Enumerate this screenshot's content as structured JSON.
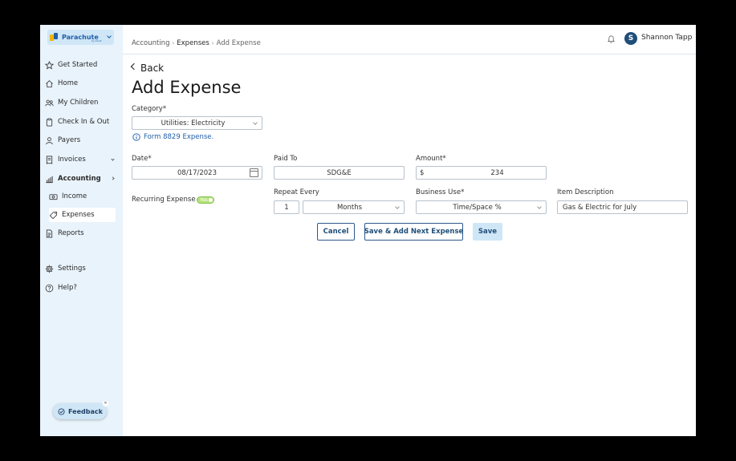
{
  "app": {
    "logo_text": "Parachute",
    "logo_sub": "by Intuit",
    "accent": "#1f5fa8"
  },
  "sidebar": {
    "items": [
      {
        "label": "Get Started",
        "icon": "star-icon"
      },
      {
        "label": "Home",
        "icon": "home-icon"
      },
      {
        "label": "My Children",
        "icon": "people-icon"
      },
      {
        "label": "Check In & Out",
        "icon": "clipboard-icon"
      },
      {
        "label": "Payers",
        "icon": "person-icon"
      },
      {
        "label": "Invoices",
        "icon": "invoice-icon"
      },
      {
        "label": "Accounting",
        "icon": "bar-chart-icon"
      },
      {
        "label": "Income",
        "icon": "cash-icon"
      },
      {
        "label": "Expenses",
        "icon": "tag-icon"
      },
      {
        "label": "Reports",
        "icon": "report-icon"
      },
      {
        "label": "Settings",
        "icon": "gear-icon"
      },
      {
        "label": "Help?",
        "icon": "help-icon"
      }
    ],
    "feedback_label": "Feedback"
  },
  "header": {
    "breadcrumb": [
      "Accounting",
      "Expenses",
      "Add Expense"
    ],
    "user_initial": "S",
    "user_name": "Shannon Tapp"
  },
  "form": {
    "back_label": "Back",
    "title": "Add Expense",
    "category_label": "Category*",
    "category_value": "Utilities: Electricity",
    "info_text": "Form 8829 Expense.",
    "date_label": "Date*",
    "date_value": "08/17/2023",
    "paid_to_label": "Paid To",
    "paid_to_value": "SDG&E",
    "amount_label": "Amount*",
    "amount_currency": "$",
    "amount_value": "234",
    "recurring_label": "Recurring Expense",
    "recurring_toggle": "Yes",
    "repeat_label": "Repeat Every",
    "repeat_count": "1",
    "repeat_unit": "Months",
    "business_use_label": "Business Use*",
    "business_use_value": "Time/Space %",
    "item_desc_label": "Item Description",
    "item_desc_value": "Gas & Electric for July",
    "cancel_label": "Cancel",
    "save_next_label": "Save & Add Next Expense",
    "save_label": "Save"
  }
}
